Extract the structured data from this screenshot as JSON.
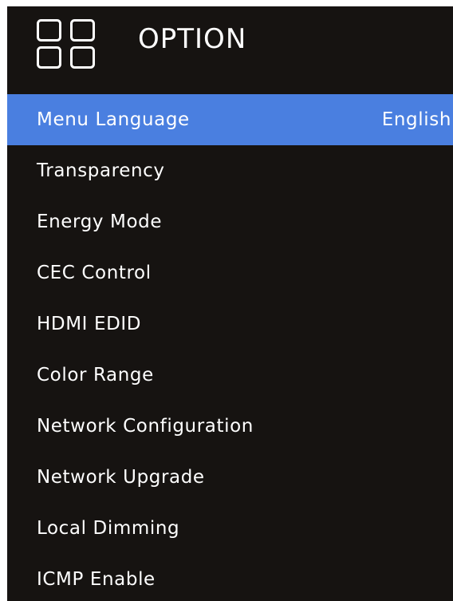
{
  "header": {
    "title": "OPTION",
    "icon": "grid-icon"
  },
  "menu": {
    "selected_index": 0,
    "items": [
      {
        "label": "Menu Language",
        "value": "English"
      },
      {
        "label": "Transparency"
      },
      {
        "label": "Energy Mode"
      },
      {
        "label": "CEC Control"
      },
      {
        "label": "HDMI EDID"
      },
      {
        "label": "Color Range"
      },
      {
        "label": "Network Configuration"
      },
      {
        "label": "Network Upgrade"
      },
      {
        "label": "Local Dimming"
      },
      {
        "label": "ICMP Enable"
      }
    ]
  },
  "colors": {
    "background": "#161311",
    "highlight": "#4a7fe0",
    "text": "#ffffff"
  }
}
